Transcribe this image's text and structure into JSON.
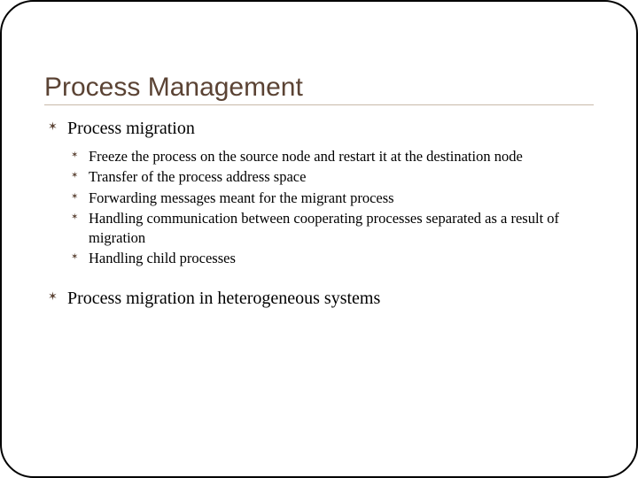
{
  "title": "Process Management",
  "items": [
    {
      "label": "Process migration",
      "sub": [
        "Freeze the process on the source node and restart it at the destination node",
        "Transfer of the process address space",
        "Forwarding messages meant for the migrant process",
        "Handling communication between cooperating processes separated as a result of migration",
        "Handling child processes"
      ]
    },
    {
      "label": "Process migration in heterogeneous systems",
      "sub": []
    }
  ]
}
